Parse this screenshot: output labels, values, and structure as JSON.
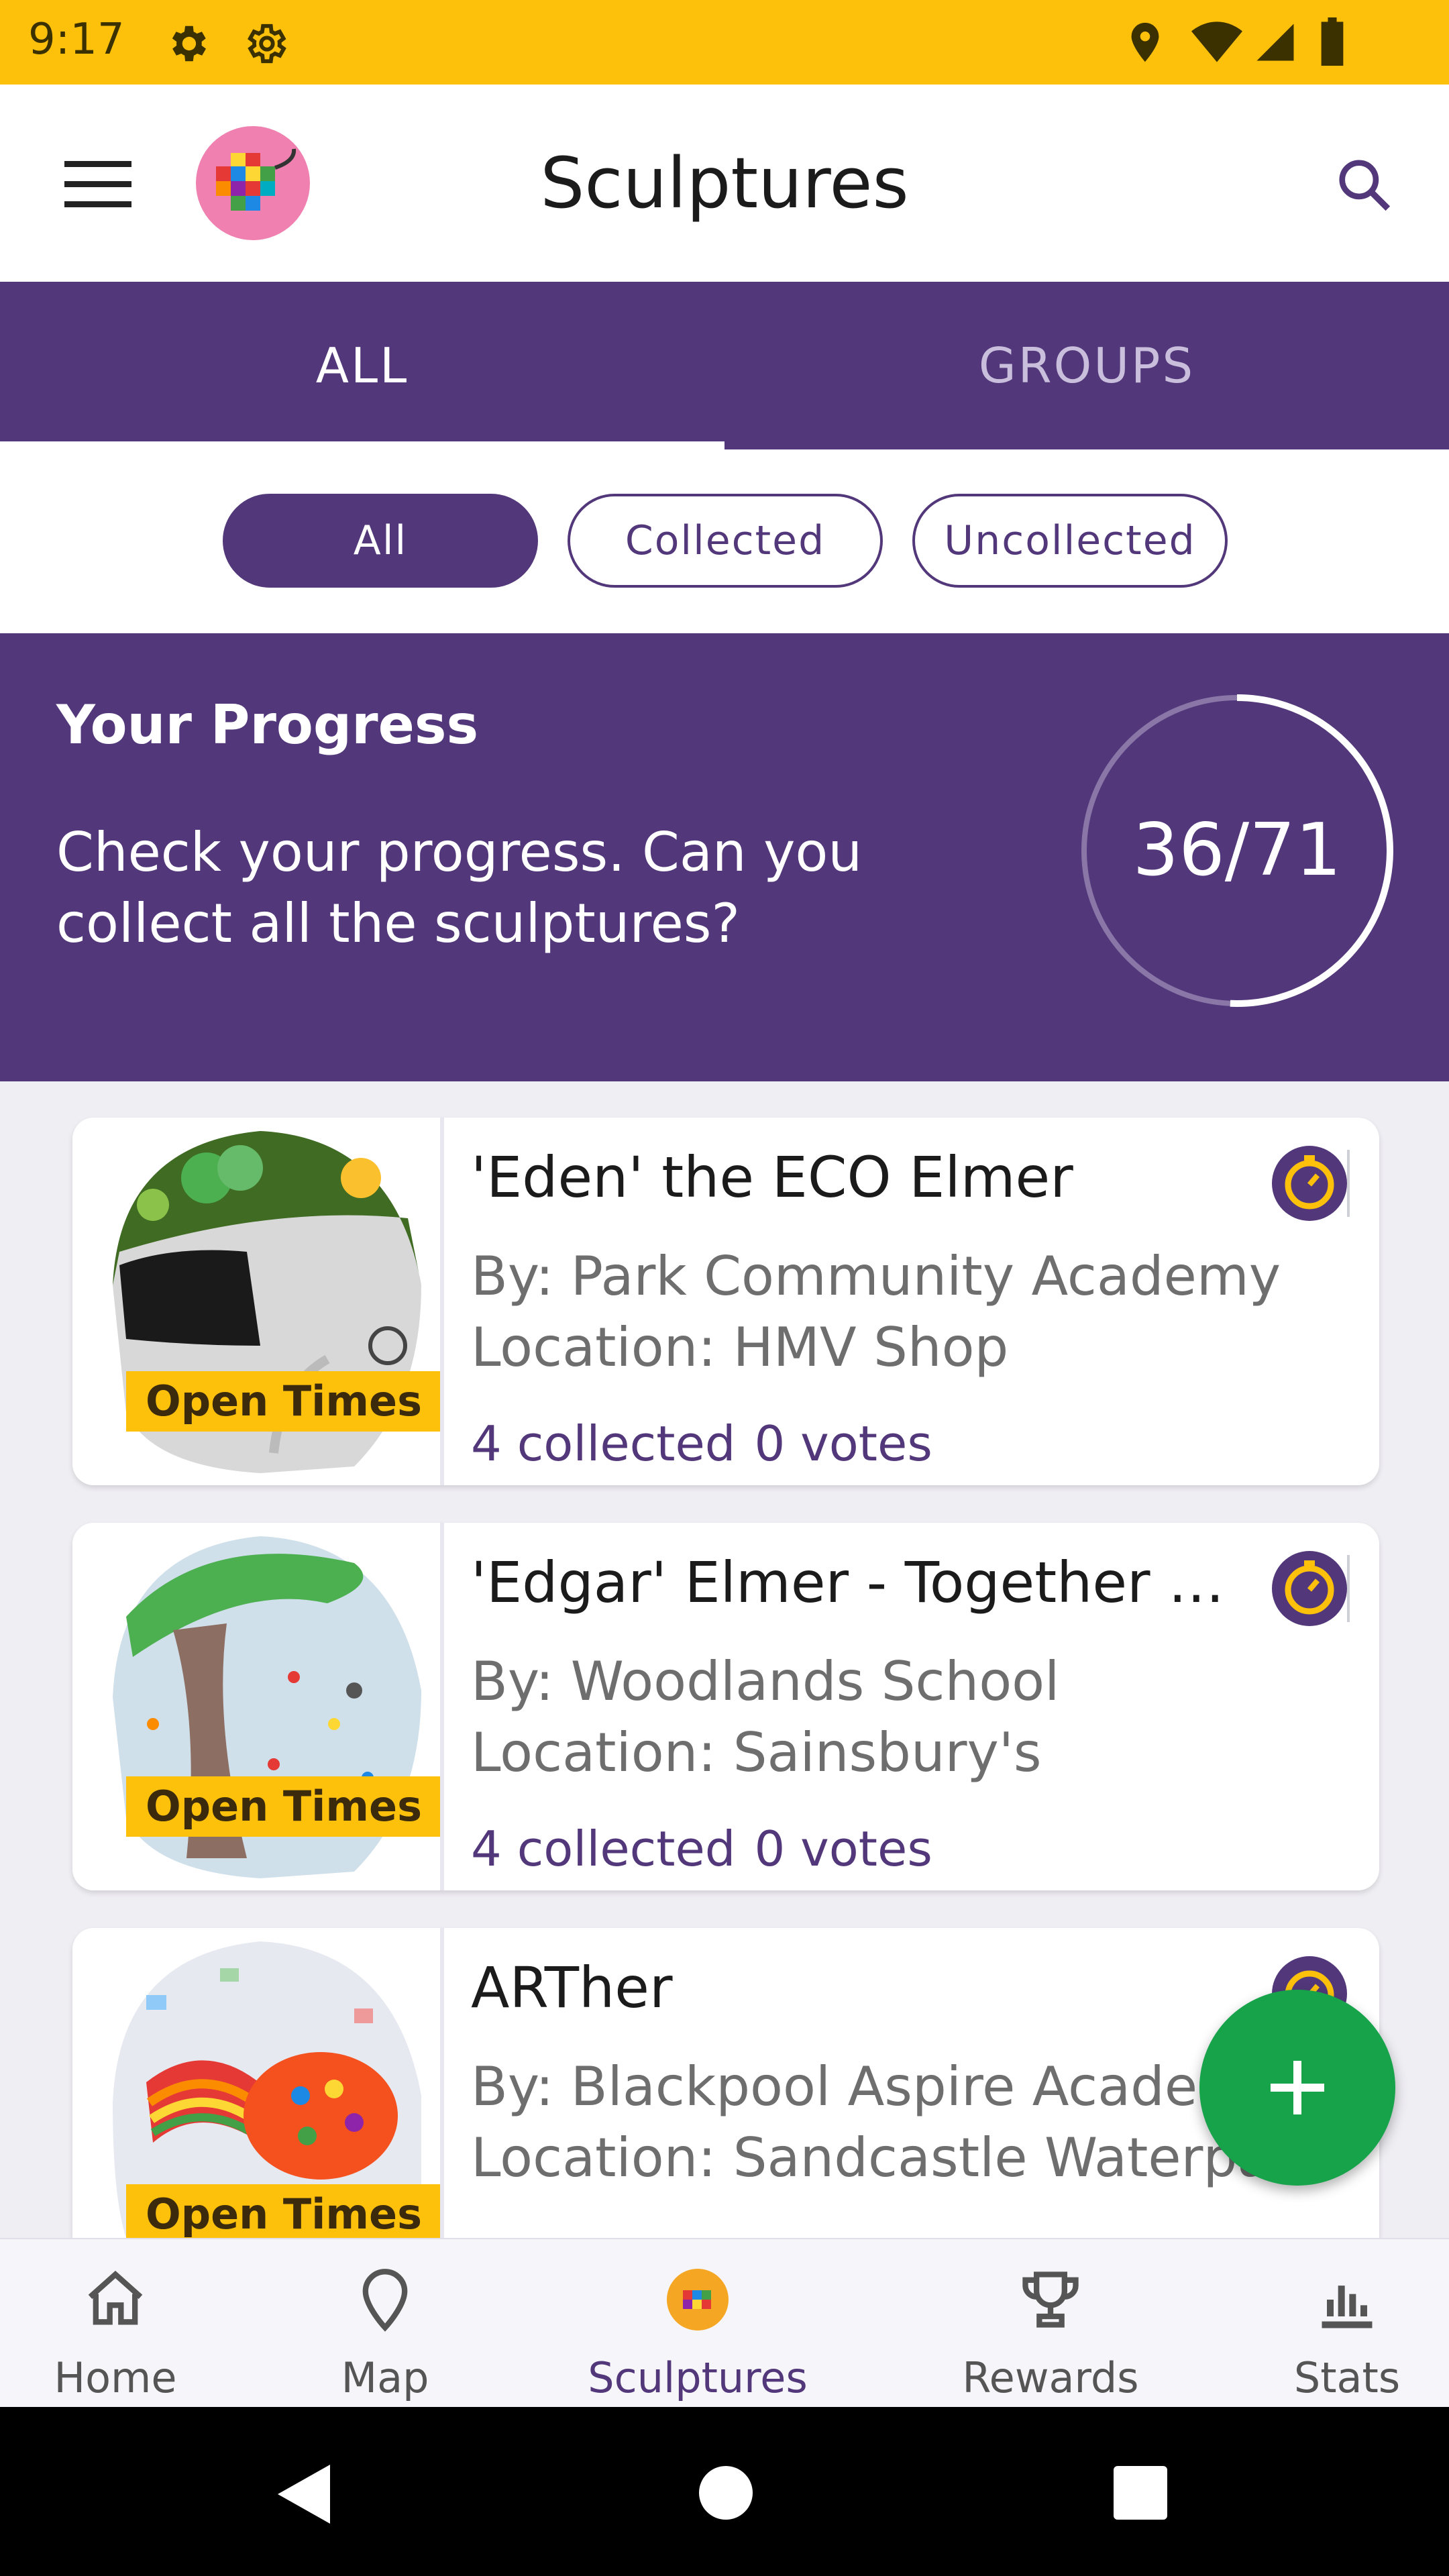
{
  "status_bar": {
    "time": "9:17",
    "icons": [
      "gear-icon",
      "gear-outline-icon",
      "location-icon",
      "wifi-icon",
      "signal-icon",
      "battery-icon"
    ]
  },
  "app_bar": {
    "title": "Sculptures",
    "icons": [
      "menu-icon",
      "app-logo",
      "search-icon"
    ]
  },
  "tabs": [
    {
      "label": "ALL",
      "active": true
    },
    {
      "label": "GROUPS",
      "active": false
    }
  ],
  "filters": [
    {
      "label": "All",
      "selected": true
    },
    {
      "label": "Collected",
      "selected": false
    },
    {
      "label": "Uncollected",
      "selected": false
    }
  ],
  "progress": {
    "title": "Your Progress",
    "description": "Check your progress. Can you collect all the sculptures?",
    "count_text": "36/71",
    "collected": 36,
    "total": 71
  },
  "sculptures": [
    {
      "name": "'Eden' the ECO Elmer",
      "by": "By: Park Community Academy",
      "location": "Location: HMV Shop",
      "collected": "4 collected",
      "votes": "0 votes",
      "badge": "Open Times"
    },
    {
      "name": "'Edgar' Elmer - Together We ...",
      "by": "By: Woodlands School",
      "location": "Location: Sainsbury's",
      "collected": "4 collected",
      "votes": "0 votes",
      "badge": "Open Times"
    },
    {
      "name": "ARTher",
      "by": "By: Blackpool Aspire Academy",
      "location": "Location: Sandcastle Waterpark",
      "collected": "",
      "votes": "",
      "badge": "Open Times"
    }
  ],
  "bottom_nav": [
    {
      "label": "Home",
      "icon": "home-icon",
      "active": false
    },
    {
      "label": "Map",
      "icon": "map-pin-icon",
      "active": false
    },
    {
      "label": "Sculptures",
      "icon": "sculptures-icon",
      "active": true
    },
    {
      "label": "Rewards",
      "icon": "trophy-icon",
      "active": false
    },
    {
      "label": "Stats",
      "icon": "stats-icon",
      "active": false
    }
  ],
  "colors": {
    "status_bar": "#fdc10c",
    "primary": "#52387a",
    "accent": "#fdc10c",
    "fab": "#16a34a"
  }
}
